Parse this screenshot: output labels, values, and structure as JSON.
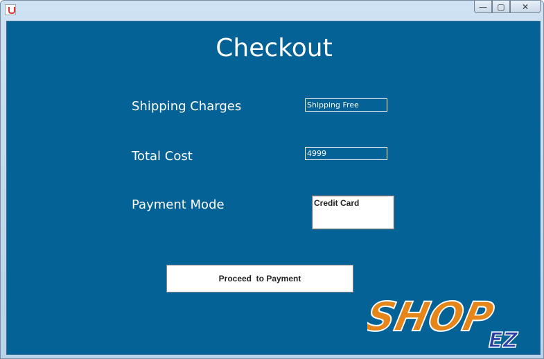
{
  "window": {
    "minimize_symbol": "—",
    "maximize_symbol": "▢",
    "close_symbol": "✕"
  },
  "page": {
    "title": "Checkout"
  },
  "form": {
    "shipping_label": "Shipping Charges",
    "shipping_value": "Shipping Free",
    "total_label": "Total Cost",
    "total_value": "4999",
    "payment_label": "Payment Mode",
    "payment_options": [
      "Credit Card"
    ],
    "proceed_label": "Proceed  to Payment"
  },
  "logo": {
    "text_main": "SHOP",
    "text_sub": "EZ"
  },
  "colors": {
    "panel_bg": "#046297",
    "logo_orange": "#e6861a",
    "logo_blue": "#2a3fa8"
  }
}
